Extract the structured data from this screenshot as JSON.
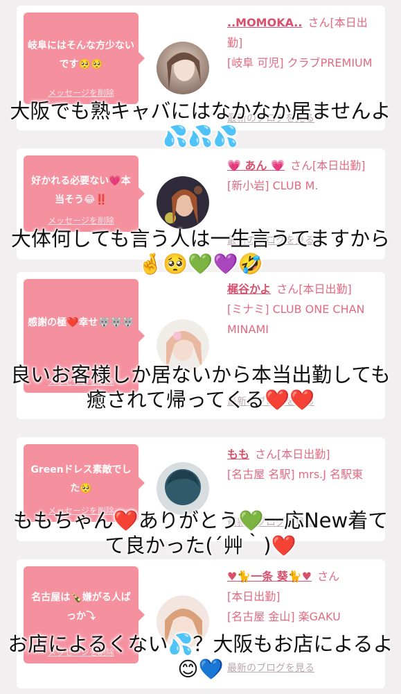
{
  "delete_label": "メッセージを削除",
  "blog_label": "最新のブログを見る",
  "san_label": "さん",
  "cards": [
    {
      "bubble": "岐阜にはそんな方少ないです🥺🥺",
      "name": "..MOMOKA..",
      "status": "[本日出勤]",
      "shop": "[岐阜 可児] クラブPREMIUM",
      "caption": "大阪でも熟キャバにはなかなか居ませんよ💦💦💦"
    },
    {
      "bubble": "好かれる必要ない💗本当そう😂‼️",
      "name": "💗 あん 💗",
      "status": "[本日出勤]",
      "shop": "[新小岩] CLUB M.",
      "caption": "大体何しても言う人は一生言うてますから🤞🥺💚💜🤣"
    },
    {
      "bubble": "感謝の極❤️幸せ🐺🐺🐺",
      "name": "梶谷かよ",
      "status": "[本日出勤]",
      "shop": "[ミナミ] CLUB ONE CHAN MINAMI",
      "caption": "良いお客様しか居ないから本当出勤しても癒されて帰ってくる❤️❤️"
    },
    {
      "bubble": "Greenドレス素敵でした🥺",
      "name": "もも",
      "status": "[本日出勤]",
      "shop": "[名古屋 名駅] mrs.J 名駅東",
      "caption": "ももちゃん❤️ありがとう💚一応New着てて良かった(´艸｀)❤️"
    },
    {
      "bubble": "名古屋は🍾嫌がる人ばっか⤵︎",
      "name": "♥🐈一条 葵🐈♥",
      "status": "[本日出勤]",
      "shop": "[名古屋 金山] 楽GAKU",
      "caption": "お店によるくない💦？大阪もお店によるよ😊💙"
    }
  ],
  "colors": {
    "bubble": "#f5909f",
    "accent": "#d8506c",
    "background": "#f1eff0"
  }
}
